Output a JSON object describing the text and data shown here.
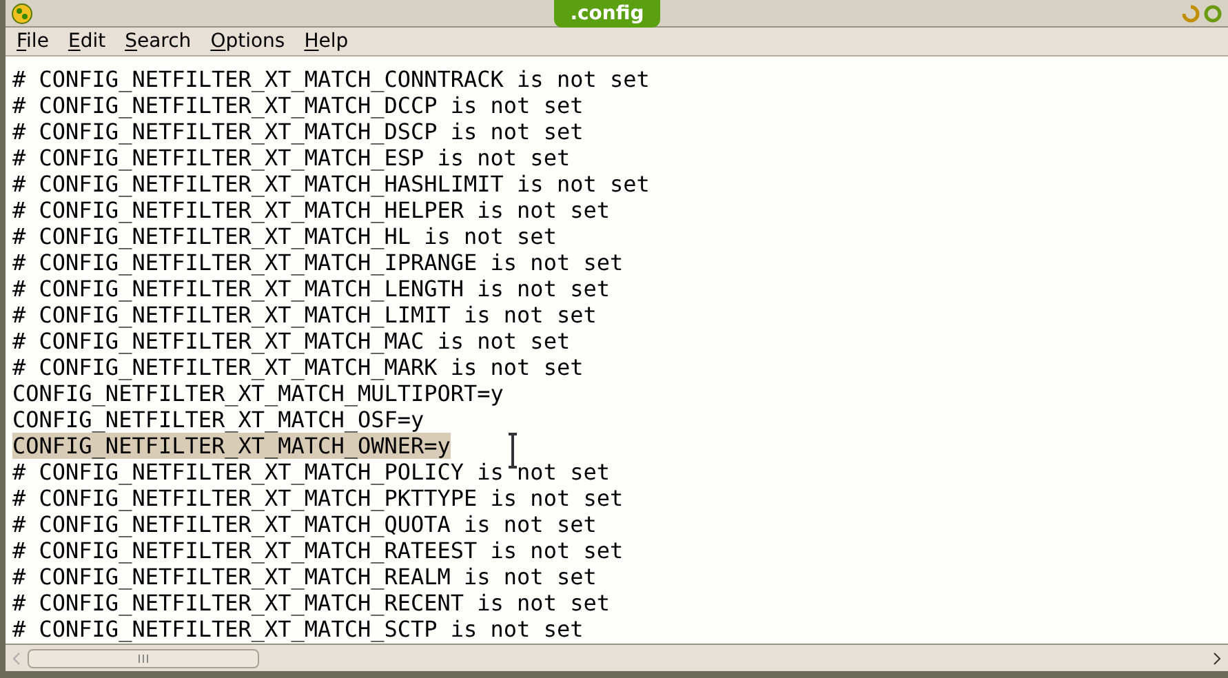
{
  "window": {
    "title": ".config"
  },
  "menu": [
    {
      "label": "File"
    },
    {
      "label": "Edit"
    },
    {
      "label": "Search"
    },
    {
      "label": "Options"
    },
    {
      "label": "Help"
    }
  ],
  "lines": [
    {
      "text": "# CONFIG_NETFILTER_XT_MATCH_CONNTRACK is not set",
      "selected": false
    },
    {
      "text": "# CONFIG_NETFILTER_XT_MATCH_DCCP is not set",
      "selected": false
    },
    {
      "text": "# CONFIG_NETFILTER_XT_MATCH_DSCP is not set",
      "selected": false
    },
    {
      "text": "# CONFIG_NETFILTER_XT_MATCH_ESP is not set",
      "selected": false
    },
    {
      "text": "# CONFIG_NETFILTER_XT_MATCH_HASHLIMIT is not set",
      "selected": false
    },
    {
      "text": "# CONFIG_NETFILTER_XT_MATCH_HELPER is not set",
      "selected": false
    },
    {
      "text": "# CONFIG_NETFILTER_XT_MATCH_HL is not set",
      "selected": false
    },
    {
      "text": "# CONFIG_NETFILTER_XT_MATCH_IPRANGE is not set",
      "selected": false
    },
    {
      "text": "# CONFIG_NETFILTER_XT_MATCH_LENGTH is not set",
      "selected": false
    },
    {
      "text": "# CONFIG_NETFILTER_XT_MATCH_LIMIT is not set",
      "selected": false
    },
    {
      "text": "# CONFIG_NETFILTER_XT_MATCH_MAC is not set",
      "selected": false
    },
    {
      "text": "# CONFIG_NETFILTER_XT_MATCH_MARK is not set",
      "selected": false
    },
    {
      "text": "CONFIG_NETFILTER_XT_MATCH_MULTIPORT=y",
      "selected": false
    },
    {
      "text": "CONFIG_NETFILTER_XT_MATCH_OSF=y",
      "selected": false
    },
    {
      "text": "CONFIG_NETFILTER_XT_MATCH_OWNER=y",
      "selected": true
    },
    {
      "text": "# CONFIG_NETFILTER_XT_MATCH_POLICY is not set",
      "selected": false
    },
    {
      "text": "# CONFIG_NETFILTER_XT_MATCH_PKTTYPE is not set",
      "selected": false
    },
    {
      "text": "# CONFIG_NETFILTER_XT_MATCH_QUOTA is not set",
      "selected": false
    },
    {
      "text": "# CONFIG_NETFILTER_XT_MATCH_RATEEST is not set",
      "selected": false
    },
    {
      "text": "# CONFIG_NETFILTER_XT_MATCH_REALM is not set",
      "selected": false
    },
    {
      "text": "# CONFIG_NETFILTER_XT_MATCH_RECENT is not set",
      "selected": false
    },
    {
      "text": "# CONFIG_NETFILTER_XT_MATCH_SCTP is not set",
      "selected": false
    }
  ]
}
